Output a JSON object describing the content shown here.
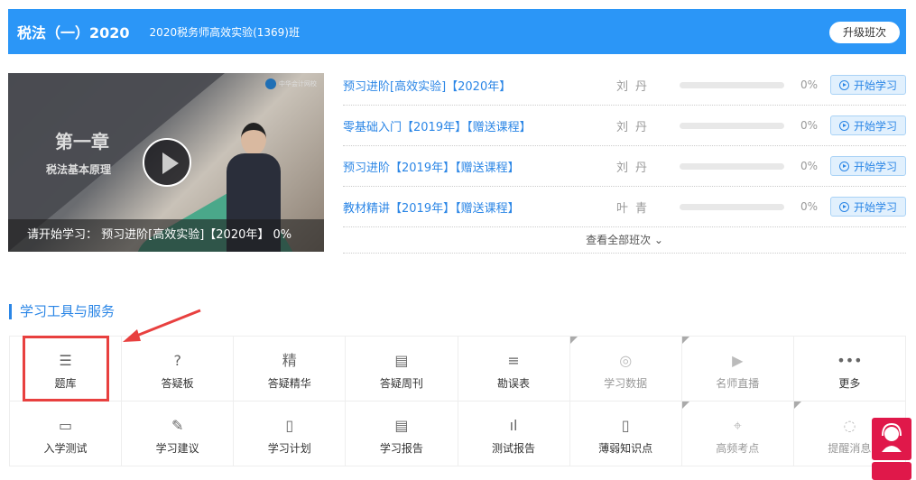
{
  "banner": {
    "title": "税法（一）2020",
    "class_name": "2020税务师高效实验(1369)班",
    "upgrade_label": "升级班次"
  },
  "video": {
    "chapter": "第一章",
    "subtitle": "税法基本原理",
    "logo_text": "中华会计网校",
    "status": "请开始学习： 预习进阶[高效实验]【2020年】 0%"
  },
  "courses": [
    {
      "name": "预习进阶[高效实验]【2020年】",
      "teacher": "刘丹",
      "progress": 0,
      "percent": "0%",
      "button": "开始学习"
    },
    {
      "name": "零基础入门【2019年】【赠送课程】",
      "teacher": "刘丹",
      "progress": 0,
      "percent": "0%",
      "button": "开始学习"
    },
    {
      "name": "预习进阶【2019年】【赠送课程】",
      "teacher": "刘丹",
      "progress": 0,
      "percent": "0%",
      "button": "开始学习"
    },
    {
      "name": "教材精讲【2019年】【赠送课程】",
      "teacher": "叶青",
      "progress": 0,
      "percent": "0%",
      "button": "开始学习"
    }
  ],
  "view_all": "查看全部班次 ⌄",
  "tools": {
    "title": "学习工具与服务",
    "items": [
      {
        "label": "题库",
        "icon": "☰"
      },
      {
        "label": "答疑板",
        "icon": "?"
      },
      {
        "label": "答疑精华",
        "icon": "精"
      },
      {
        "label": "答疑周刊",
        "icon": "▤"
      },
      {
        "label": "勘误表",
        "icon": "≡"
      },
      {
        "label": "学习数据",
        "icon": "◎"
      },
      {
        "label": "名师直播",
        "icon": "▶"
      },
      {
        "label": "更多",
        "icon": "•••"
      },
      {
        "label": "入学测试",
        "icon": "▭"
      },
      {
        "label": "学习建议",
        "icon": "✎"
      },
      {
        "label": "学习计划",
        "icon": "▯"
      },
      {
        "label": "学习报告",
        "icon": "▤"
      },
      {
        "label": "测试报告",
        "icon": "ıl"
      },
      {
        "label": "薄弱知识点",
        "icon": "▯"
      },
      {
        "label": "高频考点",
        "icon": "⌖"
      },
      {
        "label": "提醒消息",
        "icon": "◌"
      }
    ]
  },
  "colors": {
    "accent": "#2b96f7",
    "highlight": "#e8403f",
    "float": "#e0184a"
  }
}
